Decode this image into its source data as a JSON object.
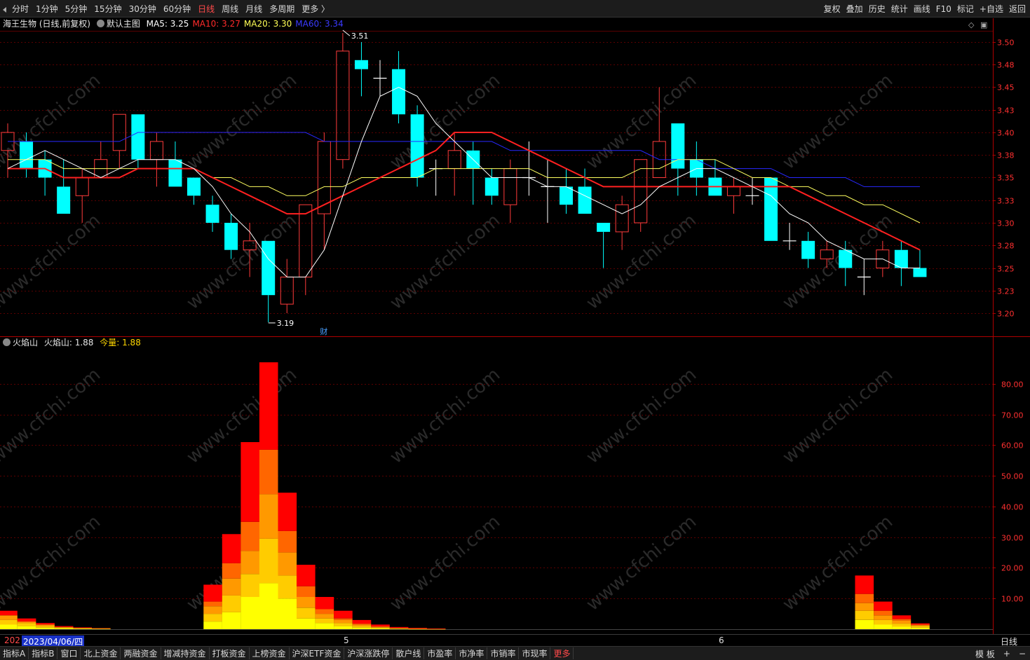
{
  "toolbar": {
    "tabs": [
      "分时",
      "1分钟",
      "5分钟",
      "15分钟",
      "30分钟",
      "60分钟",
      "日线",
      "周线",
      "月线",
      "多周期",
      "更多 〉"
    ],
    "active_tab": "日线",
    "right_buttons": [
      "复权",
      "叠加",
      "历史",
      "统计",
      "画线",
      "F10",
      "标记",
      "+自选",
      "返回"
    ]
  },
  "price_panel": {
    "title": "海王生物 (日线,前复权)",
    "template": "默认主图",
    "ma": [
      {
        "label": "MA5: 3.25",
        "color": "#ffffff"
      },
      {
        "label": "MA10: 3.27",
        "color": "#ff2a2a"
      },
      {
        "label": "MA20: 3.30",
        "color": "#ffff55"
      },
      {
        "label": "MA60: 3.34",
        "color": "#3a3aff"
      }
    ],
    "high_label": "3.51",
    "low_label": "3.19",
    "finance_marker": "财",
    "y_ticks": [
      "3.50",
      "3.48",
      "3.45",
      "3.43",
      "3.40",
      "3.38",
      "3.35",
      "3.33",
      "3.30",
      "3.28",
      "3.25",
      "3.23",
      "3.20"
    ]
  },
  "indicator_panel": {
    "name": "火焰山",
    "value_label": "火焰山: 1.88",
    "volume_label": "今量: 1.88",
    "y_ticks": [
      "80.00",
      "70.00",
      "60.00",
      "50.00",
      "40.00",
      "30.00",
      "20.00",
      "10.00"
    ]
  },
  "date_axis": {
    "left_stub": "202",
    "cursor_date": "2023/04/06/四",
    "months": [
      "5",
      "6"
    ],
    "period_label": "日线"
  },
  "bottom_tabs": [
    "指标A",
    "指标B",
    "窗口",
    "北上资金",
    "两融资金",
    "增减持资金",
    "打板资金",
    "上榜资金",
    "沪深ETF资金",
    "沪深涨跌停",
    "散户线",
    "市盈率",
    "市净率",
    "市销率",
    "市现率",
    "更多"
  ],
  "bottom_right": [
    "模 板",
    "+",
    "−"
  ],
  "watermark": "www.cfchi.com",
  "colors": {
    "up": "#ff3b3b",
    "down": "#00ffff",
    "ma5": "#ffffff",
    "ma10": "#ff2020",
    "ma20": "#ffff60",
    "ma60": "#2828ff",
    "grid": "#5a0000",
    "axis": "#b00000"
  },
  "chart_data": [
    {
      "type": "candlestick",
      "title": "海王生物 (日线,前复权)",
      "ylim": [
        3.18,
        3.52
      ],
      "candles": [
        {
          "o": 3.38,
          "c": 3.4,
          "h": 3.41,
          "l": 3.35
        },
        {
          "o": 3.39,
          "c": 3.36,
          "h": 3.4,
          "l": 3.35
        },
        {
          "o": 3.37,
          "c": 3.35,
          "h": 3.38,
          "l": 3.33
        },
        {
          "o": 3.34,
          "c": 3.31,
          "h": 3.37,
          "l": 3.31
        },
        {
          "o": 3.33,
          "c": 3.35,
          "h": 3.36,
          "l": 3.3
        },
        {
          "o": 3.35,
          "c": 3.37,
          "h": 3.39,
          "l": 3.35
        },
        {
          "o": 3.38,
          "c": 3.42,
          "h": 3.42,
          "l": 3.36
        },
        {
          "o": 3.42,
          "c": 3.37,
          "h": 3.42,
          "l": 3.36
        },
        {
          "o": 3.37,
          "c": 3.39,
          "h": 3.4,
          "l": 3.34
        },
        {
          "o": 3.37,
          "c": 3.34,
          "h": 3.39,
          "l": 3.34
        },
        {
          "o": 3.35,
          "c": 3.33,
          "h": 3.35,
          "l": 3.32
        },
        {
          "o": 3.32,
          "c": 3.3,
          "h": 3.33,
          "l": 3.29
        },
        {
          "o": 3.3,
          "c": 3.27,
          "h": 3.31,
          "l": 3.26
        },
        {
          "o": 3.27,
          "c": 3.28,
          "h": 3.3,
          "l": 3.24
        },
        {
          "o": 3.28,
          "c": 3.22,
          "h": 3.28,
          "l": 3.19
        },
        {
          "o": 3.21,
          "c": 3.24,
          "h": 3.26,
          "l": 3.2
        },
        {
          "o": 3.24,
          "c": 3.32,
          "h": 3.32,
          "l": 3.22
        },
        {
          "o": 3.31,
          "c": 3.39,
          "h": 3.4,
          "l": 3.27
        },
        {
          "o": 3.37,
          "c": 3.49,
          "h": 3.51,
          "l": 3.36
        },
        {
          "o": 3.48,
          "c": 3.47,
          "h": 3.5,
          "l": 3.44
        },
        {
          "o": 3.46,
          "c": 3.46,
          "h": 3.48,
          "l": 3.44
        },
        {
          "o": 3.47,
          "c": 3.42,
          "h": 3.49,
          "l": 3.41
        },
        {
          "o": 3.42,
          "c": 3.35,
          "h": 3.43,
          "l": 3.34
        },
        {
          "o": 3.36,
          "c": 3.36,
          "h": 3.37,
          "l": 3.33
        },
        {
          "o": 3.36,
          "c": 3.38,
          "h": 3.4,
          "l": 3.33
        },
        {
          "o": 3.38,
          "c": 3.36,
          "h": 3.39,
          "l": 3.32
        },
        {
          "o": 3.35,
          "c": 3.33,
          "h": 3.36,
          "l": 3.32
        },
        {
          "o": 3.32,
          "c": 3.36,
          "h": 3.37,
          "l": 3.3
        },
        {
          "o": 3.35,
          "c": 3.35,
          "h": 3.39,
          "l": 3.33
        },
        {
          "o": 3.34,
          "c": 3.34,
          "h": 3.37,
          "l": 3.3
        },
        {
          "o": 3.34,
          "c": 3.32,
          "h": 3.36,
          "l": 3.31
        },
        {
          "o": 3.34,
          "c": 3.31,
          "h": 3.36,
          "l": 3.31
        },
        {
          "o": 3.3,
          "c": 3.29,
          "h": 3.3,
          "l": 3.25
        },
        {
          "o": 3.29,
          "c": 3.32,
          "h": 3.33,
          "l": 3.27
        },
        {
          "o": 3.3,
          "c": 3.37,
          "h": 3.37,
          "l": 3.29
        },
        {
          "o": 3.35,
          "c": 3.39,
          "h": 3.45,
          "l": 3.35
        },
        {
          "o": 3.41,
          "c": 3.36,
          "h": 3.41,
          "l": 3.33
        },
        {
          "o": 3.37,
          "c": 3.35,
          "h": 3.39,
          "l": 3.33
        },
        {
          "o": 3.35,
          "c": 3.33,
          "h": 3.37,
          "l": 3.33
        },
        {
          "o": 3.33,
          "c": 3.34,
          "h": 3.35,
          "l": 3.31
        },
        {
          "o": 3.33,
          "c": 3.33,
          "h": 3.35,
          "l": 3.32
        },
        {
          "o": 3.35,
          "c": 3.28,
          "h": 3.35,
          "l": 3.28
        },
        {
          "o": 3.28,
          "c": 3.28,
          "h": 3.3,
          "l": 3.27
        },
        {
          "o": 3.28,
          "c": 3.26,
          "h": 3.29,
          "l": 3.25
        },
        {
          "o": 3.26,
          "c": 3.27,
          "h": 3.28,
          "l": 3.25
        },
        {
          "o": 3.27,
          "c": 3.25,
          "h": 3.28,
          "l": 3.23
        },
        {
          "o": 3.24,
          "c": 3.24,
          "h": 3.26,
          "l": 3.22
        },
        {
          "o": 3.25,
          "c": 3.27,
          "h": 3.28,
          "l": 3.24
        },
        {
          "o": 3.27,
          "c": 3.25,
          "h": 3.28,
          "l": 3.23
        },
        {
          "o": 3.25,
          "c": 3.24,
          "h": 3.27,
          "l": 3.24
        }
      ],
      "ma5": [
        3.36,
        3.37,
        3.38,
        3.37,
        3.36,
        3.35,
        3.36,
        3.37,
        3.37,
        3.37,
        3.36,
        3.34,
        3.31,
        3.29,
        3.26,
        3.24,
        3.24,
        3.27,
        3.33,
        3.39,
        3.44,
        3.45,
        3.44,
        3.41,
        3.39,
        3.37,
        3.35,
        3.35,
        3.35,
        3.34,
        3.34,
        3.33,
        3.32,
        3.31,
        3.32,
        3.34,
        3.35,
        3.36,
        3.36,
        3.35,
        3.34,
        3.33,
        3.31,
        3.3,
        3.28,
        3.27,
        3.26,
        3.26,
        3.25,
        3.25
      ],
      "ma10": [
        3.36,
        3.36,
        3.36,
        3.35,
        3.35,
        3.35,
        3.35,
        3.36,
        3.36,
        3.36,
        3.36,
        3.35,
        3.34,
        3.33,
        3.32,
        3.31,
        3.31,
        3.32,
        3.33,
        3.34,
        3.35,
        3.36,
        3.37,
        3.38,
        3.4,
        3.4,
        3.4,
        3.39,
        3.38,
        3.37,
        3.36,
        3.35,
        3.34,
        3.34,
        3.34,
        3.34,
        3.34,
        3.34,
        3.34,
        3.34,
        3.34,
        3.34,
        3.34,
        3.33,
        3.32,
        3.31,
        3.3,
        3.29,
        3.28,
        3.27
      ],
      "ma20": [
        3.37,
        3.37,
        3.37,
        3.36,
        3.36,
        3.36,
        3.36,
        3.36,
        3.36,
        3.36,
        3.36,
        3.35,
        3.35,
        3.34,
        3.34,
        3.33,
        3.33,
        3.34,
        3.34,
        3.35,
        3.35,
        3.35,
        3.35,
        3.36,
        3.36,
        3.36,
        3.36,
        3.36,
        3.36,
        3.35,
        3.35,
        3.35,
        3.35,
        3.35,
        3.36,
        3.36,
        3.37,
        3.37,
        3.37,
        3.36,
        3.35,
        3.35,
        3.34,
        3.34,
        3.33,
        3.33,
        3.32,
        3.32,
        3.31,
        3.3
      ],
      "ma60": [
        3.39,
        3.39,
        3.39,
        3.39,
        3.39,
        3.39,
        3.39,
        3.4,
        3.4,
        3.4,
        3.4,
        3.4,
        3.4,
        3.4,
        3.4,
        3.4,
        3.4,
        3.39,
        3.39,
        3.39,
        3.39,
        3.39,
        3.39,
        3.39,
        3.39,
        3.39,
        3.39,
        3.38,
        3.38,
        3.38,
        3.38,
        3.38,
        3.38,
        3.38,
        3.38,
        3.37,
        3.37,
        3.37,
        3.36,
        3.36,
        3.36,
        3.36,
        3.35,
        3.35,
        3.35,
        3.35,
        3.34,
        3.34,
        3.34,
        3.34
      ]
    },
    {
      "type": "bar",
      "title": "火焰山",
      "ylim": [
        0,
        90
      ],
      "layers_note": "stacked bands (light to dark): yellow, amber, orange, dark orange, red",
      "bars": [
        {
          "i": 0,
          "v": [
            1.5,
            1.5,
            1.5,
            0,
            1.5
          ]
        },
        {
          "i": 1,
          "v": [
            1,
            1,
            0.5,
            0,
            1
          ]
        },
        {
          "i": 2,
          "v": [
            0.5,
            0.5,
            0.5,
            0,
            0.5
          ]
        },
        {
          "i": 3,
          "v": [
            0.3,
            0.2,
            0.2,
            0,
            0.3
          ]
        },
        {
          "i": 4,
          "v": [
            0.2,
            0.1,
            0.1,
            0,
            0.2
          ]
        },
        {
          "i": 5,
          "v": [
            0.1,
            0.1,
            0.05,
            0,
            0.1
          ]
        },
        {
          "i": 11,
          "v": [
            2.5,
            2.5,
            2.5,
            1.5,
            5.5
          ]
        },
        {
          "i": 12,
          "v": [
            5.5,
            5.5,
            5.5,
            5,
            9.5
          ]
        },
        {
          "i": 13,
          "v": [
            10.5,
            7.5,
            7.5,
            9.5,
            26
          ]
        },
        {
          "i": 14,
          "v": [
            15,
            14.5,
            14.5,
            14.5,
            28.5
          ]
        },
        {
          "i": 15,
          "v": [
            10,
            7.5,
            7.5,
            7,
            12.5
          ]
        },
        {
          "i": 16,
          "v": [
            3.5,
            3.5,
            3.5,
            3.5,
            7
          ]
        },
        {
          "i": 17,
          "v": [
            2,
            1.5,
            1.5,
            1.5,
            4
          ]
        },
        {
          "i": 18,
          "v": [
            1,
            1,
            1,
            0.5,
            2.5
          ]
        },
        {
          "i": 19,
          "v": [
            0.5,
            0.5,
            0.5,
            0.3,
            1.2
          ]
        },
        {
          "i": 20,
          "v": [
            0.3,
            0.2,
            0.2,
            0.2,
            0.6
          ]
        },
        {
          "i": 21,
          "v": [
            0.1,
            0.1,
            0.1,
            0.1,
            0.3
          ]
        },
        {
          "i": 22,
          "v": [
            0.05,
            0.05,
            0.05,
            0.05,
            0.2
          ]
        },
        {
          "i": 23,
          "v": [
            0.05,
            0.02,
            0.02,
            0.02,
            0.1
          ]
        },
        {
          "i": 46,
          "v": [
            3,
            3,
            2.5,
            3,
            6
          ]
        },
        {
          "i": 47,
          "v": [
            1.5,
            1.5,
            1.5,
            1.5,
            3
          ]
        },
        {
          "i": 48,
          "v": [
            0.8,
            1,
            1,
            0.5,
            1.2
          ]
        },
        {
          "i": 49,
          "v": [
            0.5,
            0.5,
            0.3,
            0.2,
            0.4
          ]
        }
      ]
    }
  ]
}
